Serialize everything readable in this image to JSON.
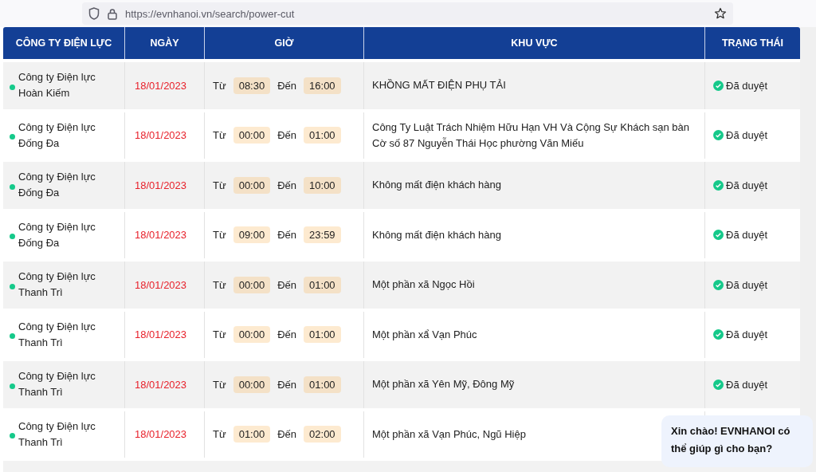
{
  "browser": {
    "url": "https://evnhanoi.vn/search/power-cut"
  },
  "table": {
    "columns": [
      "CÔNG TY ĐIỆN LỰC",
      "NGÀY",
      "GIỜ",
      "KHU VỰC",
      "TRẠNG THÁI"
    ],
    "rows": [
      {
        "company": "Công ty Điện lực Hoàn Kiếm",
        "date": "18/01/2023",
        "from_label": "Từ",
        "from": "08:30",
        "to_label": "Đến",
        "to": "16:00",
        "area": "KHỒNG MẤT ĐIỆN PHỤ TẢI",
        "status": "Đã duyệt"
      },
      {
        "company": "Công ty Điện lực Đống Đa",
        "date": "18/01/2023",
        "from_label": "Từ",
        "from": "00:00",
        "to_label": "Đến",
        "to": "01:00",
        "area": "Công Ty Luật Trách Nhiệm Hữu Hạn VH Và Cộng Sự Khách sạn bàn Cờ số 87 Nguyễn Thái Học phường Văn Miếu",
        "status": "Đã duyệt"
      },
      {
        "company": "Công ty Điện lực Đống Đa",
        "date": "18/01/2023",
        "from_label": "Từ",
        "from": "00:00",
        "to_label": "Đến",
        "to": "10:00",
        "area": "Không mất điện khách hàng",
        "status": "Đã duyệt"
      },
      {
        "company": "Công ty Điện lực Đống Đa",
        "date": "18/01/2023",
        "from_label": "Từ",
        "from": "09:00",
        "to_label": "Đến",
        "to": "23:59",
        "area": "Không mất điện khách hàng",
        "status": "Đã duyệt"
      },
      {
        "company": "Công ty Điện lực Thanh Trì",
        "date": "18/01/2023",
        "from_label": "Từ",
        "from": "00:00",
        "to_label": "Đến",
        "to": "01:00",
        "area": "Một phần xã Ngọc Hồi",
        "status": "Đã duyệt"
      },
      {
        "company": "Công ty Điện lực Thanh Trì",
        "date": "18/01/2023",
        "from_label": "Từ",
        "from": "00:00",
        "to_label": "Đến",
        "to": "01:00",
        "area": "Một phần xẩ Vạn Phúc",
        "status": "Đã duyệt"
      },
      {
        "company": "Công ty Điện lực Thanh Trì",
        "date": "18/01/2023",
        "from_label": "Từ",
        "from": "00:00",
        "to_label": "Đến",
        "to": "01:00",
        "area": "Một phần xã Yên Mỹ, Đông Mỹ",
        "status": "Đã duyệt"
      },
      {
        "company": "Công ty Điện lực Thanh Trì",
        "date": "18/01/2023",
        "from_label": "Từ",
        "from": "01:00",
        "to_label": "Đến",
        "to": "02:00",
        "area": "Một phần xã Vạn Phúc, Ngũ Hiệp"
      }
    ]
  },
  "chat_bubble": {
    "text": "Xin chào! EVNHANOI có thể giúp gì cho bạn?"
  }
}
